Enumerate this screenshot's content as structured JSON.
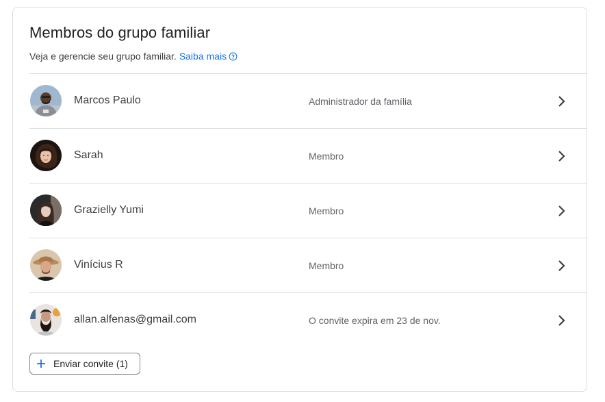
{
  "header": {
    "title": "Membros do grupo familiar",
    "subtitle": "Veja e gerencie seu grupo familiar.",
    "learn_more": "Saiba mais"
  },
  "members": [
    {
      "name": "Marcos Paulo",
      "role": "Administrador da família",
      "avatar_icon": "avatar-photo"
    },
    {
      "name": "Sarah",
      "role": "Membro",
      "avatar_icon": "avatar-photo"
    },
    {
      "name": "Grazielly Yumi",
      "role": "Membro",
      "avatar_icon": "avatar-photo"
    },
    {
      "name": "Vinícius R",
      "role": "Membro",
      "avatar_icon": "avatar-photo"
    },
    {
      "name": "allan.alfenas@gmail.com",
      "role": "O convite expira em 23 de nov.",
      "avatar_icon": "avatar-photo"
    }
  ],
  "invite_button": {
    "label": "Enviar convite (1)",
    "icon": "plus-icon"
  },
  "colors": {
    "accent": "#1a73e8",
    "border": "#dadce0",
    "text_primary": "#202124",
    "text_secondary": "#5f6368"
  }
}
